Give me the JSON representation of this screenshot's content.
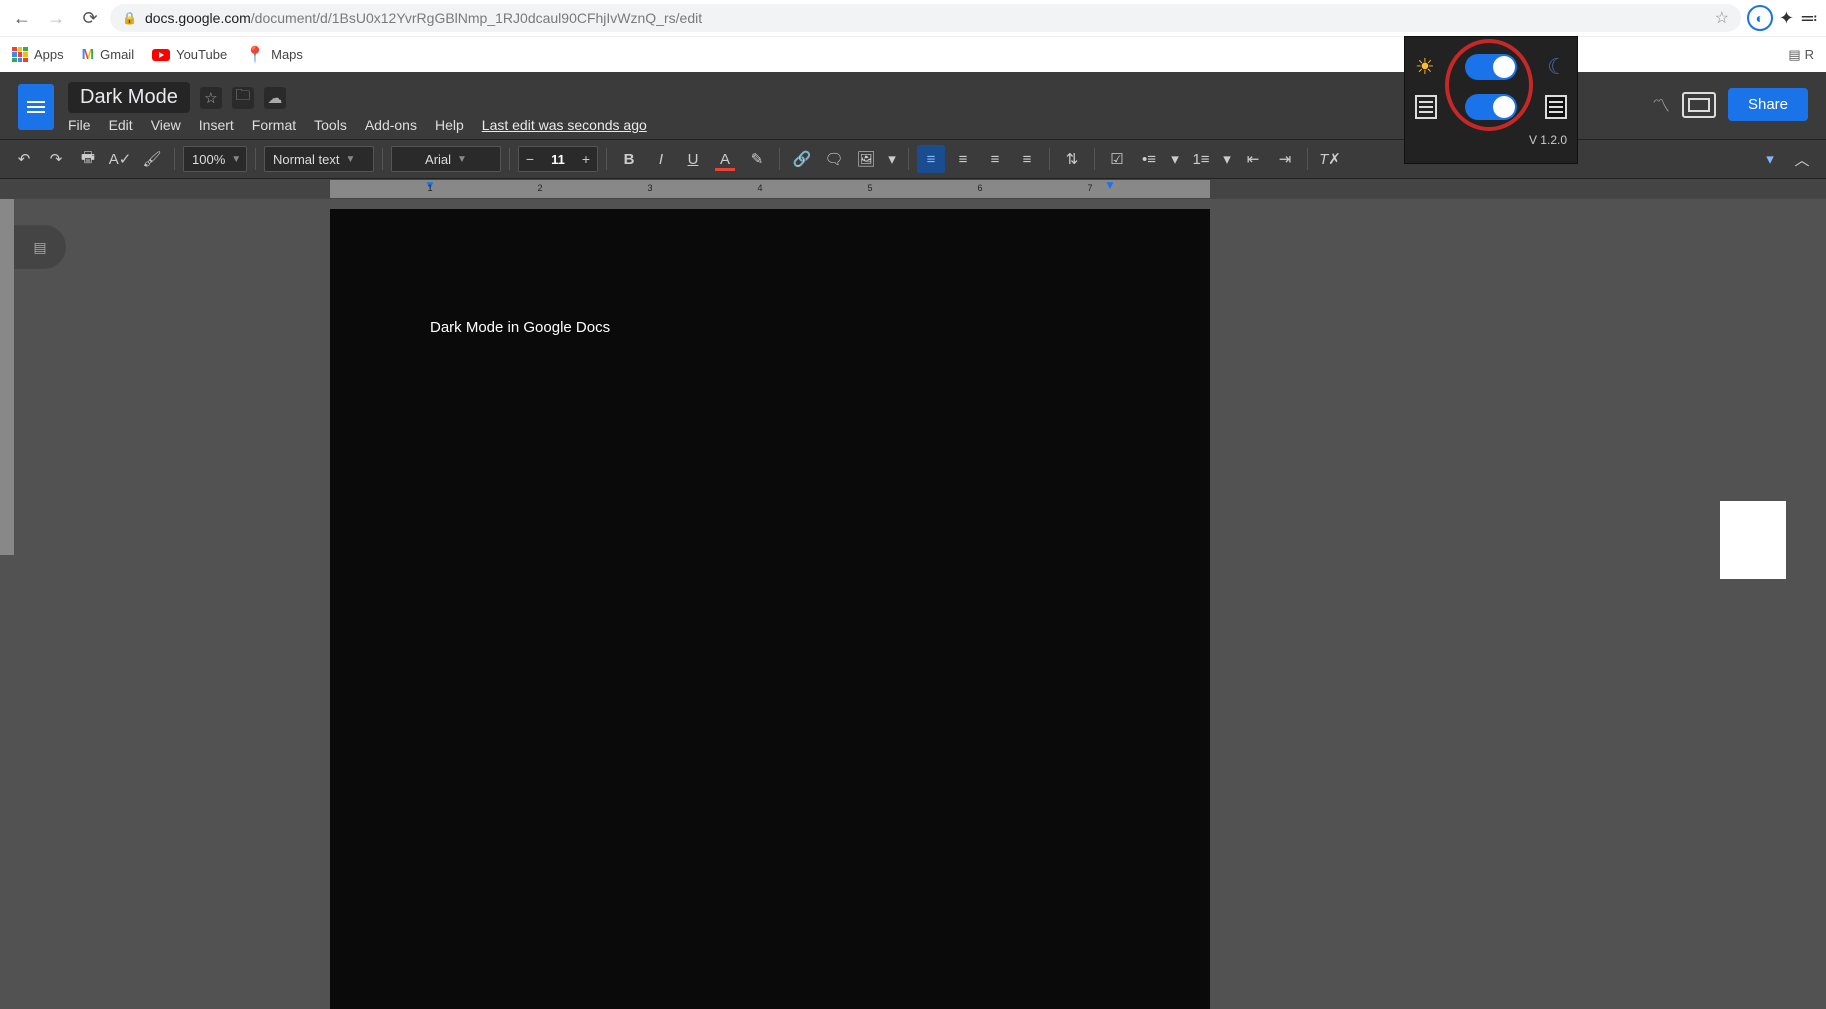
{
  "browser": {
    "url_domain": "docs.google.com",
    "url_path": "/document/d/1BsU0x12YvrRgGBlNmp_1RJ0dcaul90CFhjIvWznQ_rs/edit"
  },
  "bookmarks": {
    "apps": "Apps",
    "gmail": "Gmail",
    "youtube": "YouTube",
    "maps": "Maps",
    "reading_list_initial": "R"
  },
  "docs": {
    "title": "Dark Mode",
    "menus": [
      "File",
      "Edit",
      "View",
      "Insert",
      "Format",
      "Tools",
      "Add-ons",
      "Help"
    ],
    "last_edit": "Last edit was seconds ago",
    "share": "Share"
  },
  "toolbar": {
    "zoom": "100%",
    "style": "Normal text",
    "font": "Arial",
    "font_size": "11"
  },
  "ruler": {
    "numbers": [
      "1",
      "2",
      "3",
      "4",
      "5",
      "6",
      "7"
    ]
  },
  "document": {
    "body": "Dark Mode in Google Docs"
  },
  "extension": {
    "version": "V 1.2.0"
  }
}
